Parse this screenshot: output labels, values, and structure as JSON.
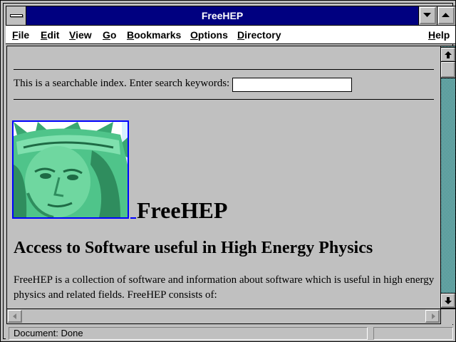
{
  "window": {
    "title": "FreeHEP"
  },
  "menu": {
    "items": [
      {
        "label": "File",
        "hot": "F",
        "rest": "ile"
      },
      {
        "label": "Edit",
        "hot": "E",
        "rest": "dit"
      },
      {
        "label": "View",
        "hot": "V",
        "rest": "iew"
      },
      {
        "label": "Go",
        "hot": "G",
        "rest": "o"
      },
      {
        "label": "Bookmarks",
        "hot": "B",
        "rest": "ookmarks"
      },
      {
        "label": "Options",
        "hot": "O",
        "rest": "ptions"
      },
      {
        "label": "Directory",
        "hot": "D",
        "rest": "irectory"
      },
      {
        "label": "Help",
        "hot": "H",
        "rest": "elp"
      }
    ]
  },
  "page": {
    "search_label": "This is a searchable index. Enter search keywords:",
    "search_value": "",
    "heading": "FreeHEP",
    "subheading": "Access to Software useful in High Energy Physics",
    "paragraph": "FreeHEP is a collection of software and information about software which is useful in high energy physics and related fields. FreeHEP consists of:"
  },
  "status": {
    "text": "Document: Done"
  },
  "colors": {
    "titlebar": "#000080",
    "link": "#0000ff",
    "scroll_track": "#008080",
    "statue": "#4fc48a"
  }
}
